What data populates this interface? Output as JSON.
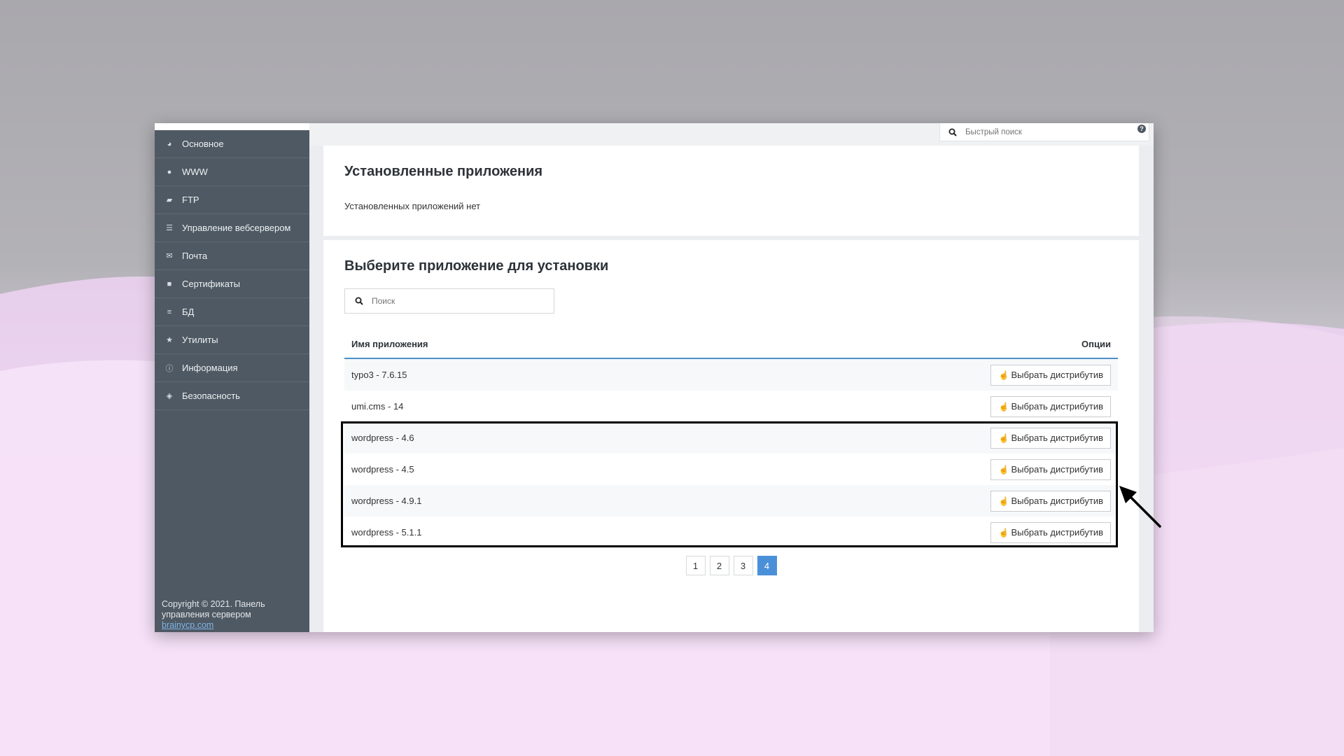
{
  "sidebar": {
    "items": [
      {
        "label": "Основное",
        "icon": "dashboard-icon"
      },
      {
        "label": "WWW",
        "icon": "globe-icon"
      },
      {
        "label": "FTP",
        "icon": "folder-open-icon"
      },
      {
        "label": "Управление вебсервером",
        "icon": "list-icon"
      },
      {
        "label": "Почта",
        "icon": "envelope-icon"
      },
      {
        "label": "Сертификаты",
        "icon": "lock-icon"
      },
      {
        "label": "БД",
        "icon": "database-icon"
      },
      {
        "label": "Утилиты",
        "icon": "star-icon"
      },
      {
        "label": "Информация",
        "icon": "info-icon"
      },
      {
        "label": "Безопасность",
        "icon": "shield-icon"
      }
    ],
    "copyright": "Copyright © 2021. Панель управления сервером",
    "copyright_link": "brainycp.com"
  },
  "header": {
    "quick_search_placeholder": "Быстрый поиск"
  },
  "installed": {
    "title": "Установленные приложения",
    "empty_message": "Установленных приложений нет"
  },
  "install": {
    "title": "Выберите приложение для установки",
    "search_placeholder": "Поиск",
    "columns": {
      "name": "Имя приложения",
      "options": "Опции"
    },
    "rows": [
      {
        "name": "typo3 - 7.6.15",
        "action": "Выбрать дистрибутив"
      },
      {
        "name": "umi.cms - 14",
        "action": "Выбрать дистрибутив"
      },
      {
        "name": "wordpress - 4.6",
        "action": "Выбрать дистрибутив"
      },
      {
        "name": "wordpress - 4.5",
        "action": "Выбрать дистрибутив"
      },
      {
        "name": "wordpress - 4.9.1",
        "action": "Выбрать дистрибутив"
      },
      {
        "name": "wordpress - 5.1.1",
        "action": "Выбрать дистрибутив"
      }
    ],
    "pages": [
      "1",
      "2",
      "3",
      "4"
    ],
    "current_page": "4"
  },
  "colors": {
    "sidebar_bg": "#4e5963",
    "accent": "#4a90d9",
    "highlight_border": "#000000"
  }
}
